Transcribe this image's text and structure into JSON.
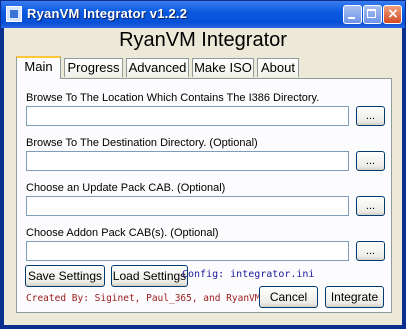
{
  "window": {
    "title": "RyanVM Integrator v1.2.2"
  },
  "app": {
    "heading": "RyanVM Integrator"
  },
  "tabs": [
    {
      "label": "Main",
      "active": true
    },
    {
      "label": "Progress",
      "active": false
    },
    {
      "label": "Advanced",
      "active": false
    },
    {
      "label": "Make ISO",
      "active": false
    },
    {
      "label": "About",
      "active": false
    }
  ],
  "main": {
    "i386_label": "Browse To The Location Which Contains The I386 Directory.",
    "i386_value": "",
    "dest_label": "Browse To The Destination Directory. (Optional)",
    "dest_value": "",
    "update_label": "Choose an Update Pack CAB. (Optional)",
    "update_value": "",
    "addon_label": "Choose Addon Pack CAB(s). (Optional)",
    "addon_value": "",
    "browse_label": "..."
  },
  "buttons": {
    "save": "Save Settings",
    "load": "Load Settings",
    "cancel": "Cancel",
    "integrate": "Integrate"
  },
  "config_text": "Config: integrator.ini",
  "credits_text": "Created By: Siginet, Paul_365, and RyanVM",
  "colors": {
    "titlebar": "#0a5ae0",
    "window_bg": "#ece9d8",
    "config_text": "#1a1a9a",
    "credits_text": "#9a1a1a",
    "active_tab_accent": "#ffc83c"
  }
}
